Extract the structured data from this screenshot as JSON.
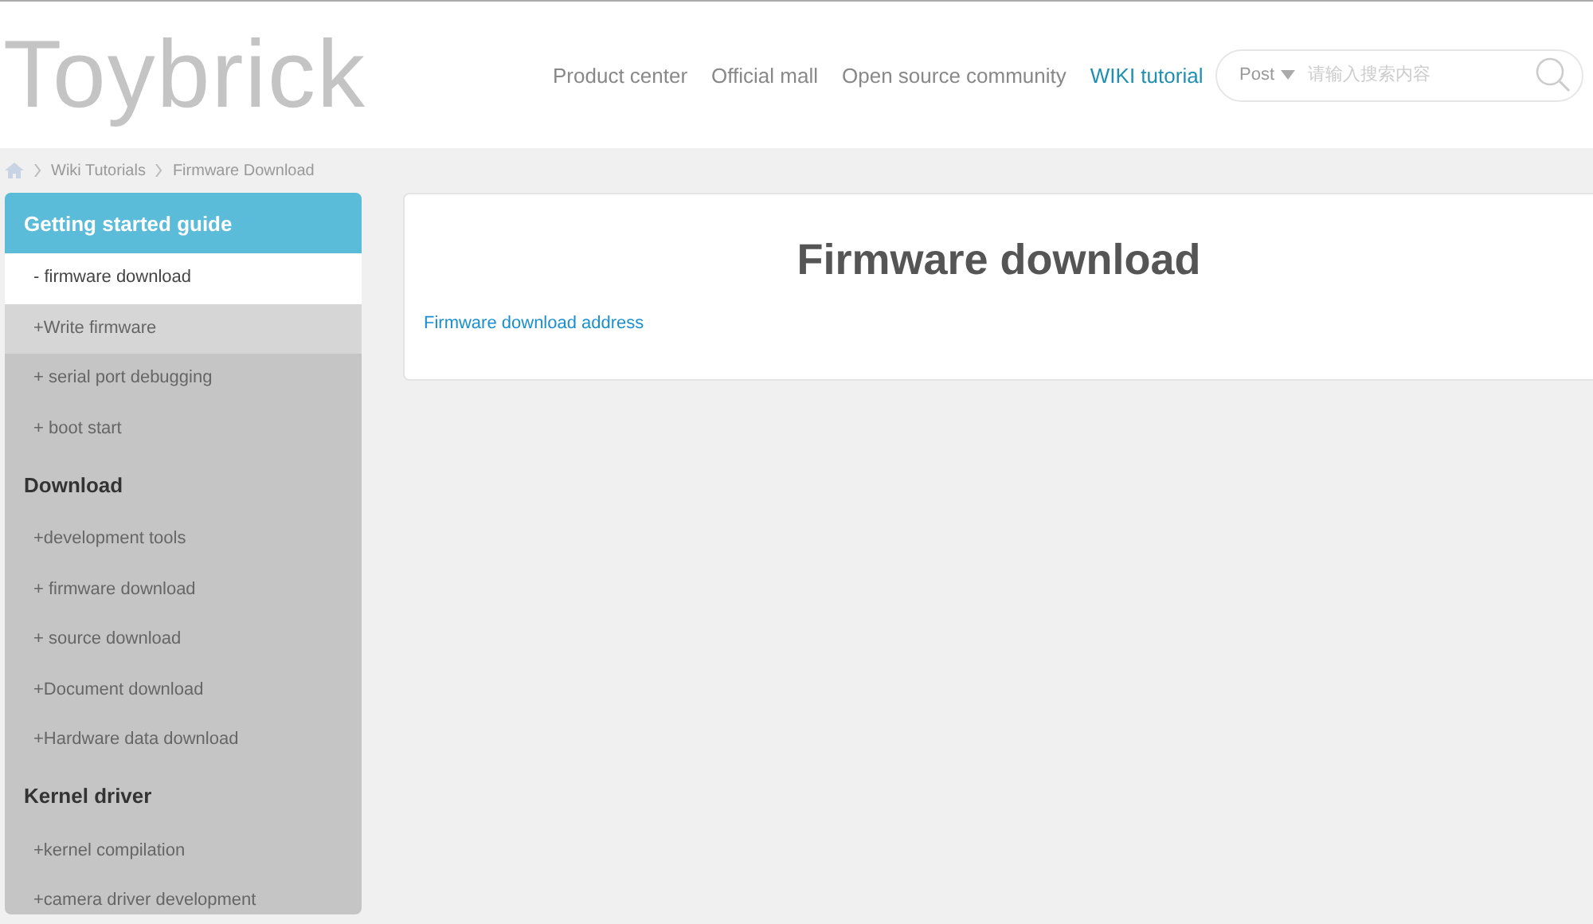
{
  "logo": {
    "text": "Toybrick"
  },
  "nav": [
    {
      "label": "Product center",
      "selected": false
    },
    {
      "label": "Official mall",
      "selected": false
    },
    {
      "label": "Open source community",
      "selected": false
    },
    {
      "label": "WIKI tutorial",
      "selected": true
    }
  ],
  "search": {
    "scope": "Post",
    "placeholder": "请输入搜索内容"
  },
  "breadcrumb": [
    "Wiki Tutorials",
    "Firmware Download"
  ],
  "sidebar": {
    "sections": [
      {
        "title": "Getting started guide",
        "selected": true,
        "items": [
          {
            "label": "- firmware download",
            "selected": true,
            "hovered": false
          },
          {
            "label": "+Write firmware",
            "selected": false,
            "hovered": true
          },
          {
            "label": "+ serial port debugging",
            "selected": false,
            "hovered": false
          },
          {
            "label": "+ boot start",
            "selected": false,
            "hovered": false
          }
        ]
      },
      {
        "title": "Download",
        "selected": false,
        "items": [
          {
            "label": "+development tools",
            "selected": false,
            "hovered": false
          },
          {
            "label": "+ firmware download",
            "selected": false,
            "hovered": false
          },
          {
            "label": "+ source download",
            "selected": false,
            "hovered": false
          },
          {
            "label": "+Document download",
            "selected": false,
            "hovered": false
          },
          {
            "label": "+Hardware data download",
            "selected": false,
            "hovered": false
          }
        ]
      },
      {
        "title": "Kernel driver",
        "selected": false,
        "items": [
          {
            "label": "+kernel compilation",
            "selected": false,
            "hovered": false
          },
          {
            "label": "+camera driver development",
            "selected": false,
            "hovered": false
          }
        ]
      }
    ]
  },
  "article": {
    "title": "Firmware download",
    "link": "Firmware download address"
  }
}
